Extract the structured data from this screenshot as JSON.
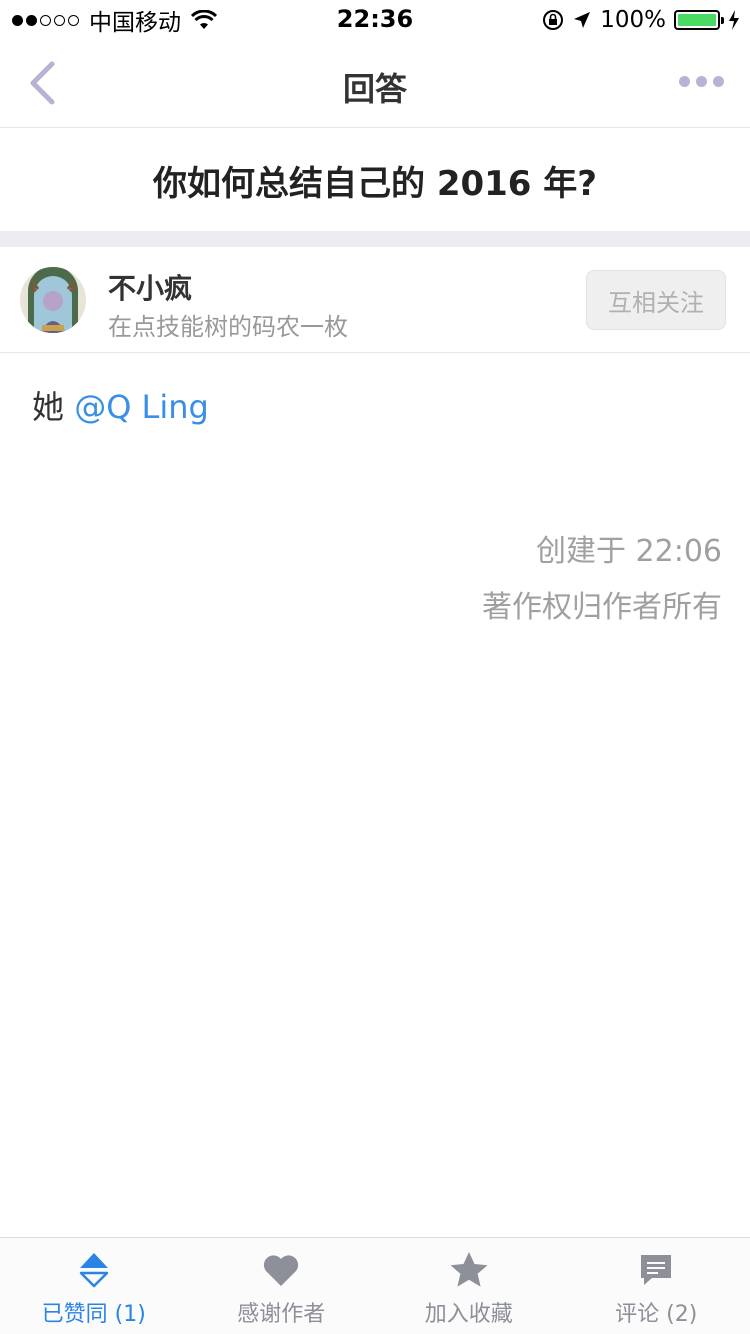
{
  "status_bar": {
    "carrier": "中国移动",
    "time": "22:36",
    "battery": "100%",
    "icons": [
      "signal-dots-icon",
      "wifi-icon",
      "orientation-lock-icon",
      "location-arrow-icon",
      "battery-icon",
      "charging-bolt-icon"
    ]
  },
  "nav": {
    "title": "回答",
    "back_icon": "chevron-left-icon",
    "more_icon": "more-dots-icon",
    "accent": "#b7b3d4"
  },
  "question": {
    "title": "你如何总结自己的 2016 年?"
  },
  "author": {
    "name": "不小疯",
    "bio": "在点技能树的码农一枚",
    "follow_label": "互相关注"
  },
  "answer": {
    "text": "她 ",
    "mention": "@Q Ling",
    "mention_color": "#3a8ee6",
    "created": "创建于 22:06",
    "copyright": "著作权归作者所有"
  },
  "tabbar": {
    "items": [
      {
        "label": "已赞同 (1)",
        "icon": "vote-up-icon",
        "active": true
      },
      {
        "label": "感谢作者",
        "icon": "heart-icon",
        "active": false
      },
      {
        "label": "加入收藏",
        "icon": "star-icon",
        "active": false
      },
      {
        "label": "评论 (2)",
        "icon": "comment-icon",
        "active": false
      }
    ],
    "active_color": "#2a84e3",
    "inactive_color": "#8e9099"
  }
}
